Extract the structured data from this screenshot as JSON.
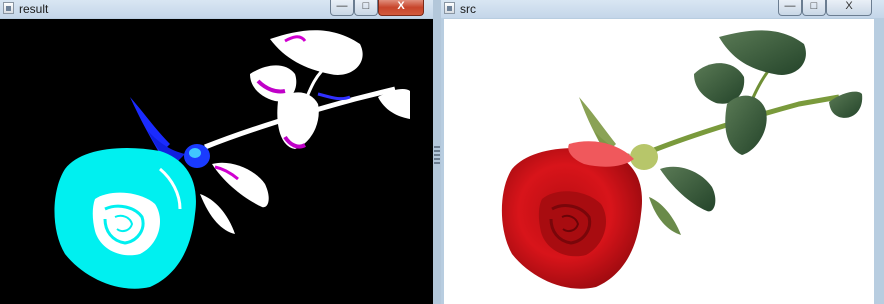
{
  "windows": [
    {
      "title": "result",
      "icon": "window-icon",
      "controls": {
        "minimize": "—",
        "maximize": "□",
        "close": "X"
      },
      "background": "#000000"
    },
    {
      "title": "src",
      "icon": "window-icon",
      "controls": {
        "minimize": "—",
        "maximize": "□",
        "close": "X"
      },
      "background": "#ffffff"
    }
  ]
}
